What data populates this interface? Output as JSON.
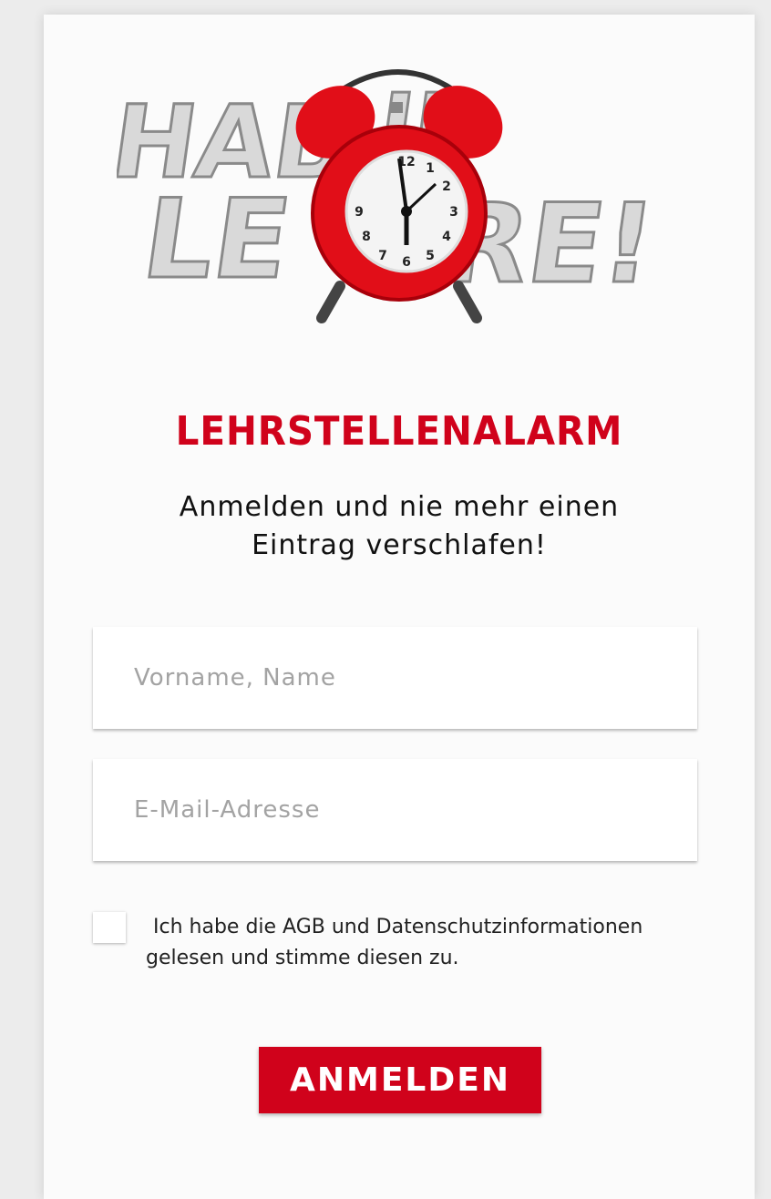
{
  "logo": {
    "alt_text": "HABE NIE LEHRE!",
    "icon": "alarm-clock-icon",
    "letters_color": "#d8d8d8",
    "clock_color": "#e10e18",
    "lettering_line1": "HABE NIE",
    "lettering_line2": "LEHRE!"
  },
  "heading": {
    "title": "LEHRSTELLENALARM",
    "subtitle_line1": "Anmelden und nie mehr einen",
    "subtitle_line2": "Eintrag verschlafen!"
  },
  "form": {
    "name_placeholder": "Vorname, Name",
    "name_value": "",
    "email_placeholder": "E-Mail-Adresse",
    "email_value": "",
    "consent_checked": false,
    "consent_text": "Ich habe die AGB und Datenschutzinformationen gelesen und stimme diesen zu.",
    "submit_label": "ANMELDEN"
  },
  "colors": {
    "accent": "#d0021b",
    "background": "#ececec",
    "card": "#fbfbfb"
  }
}
